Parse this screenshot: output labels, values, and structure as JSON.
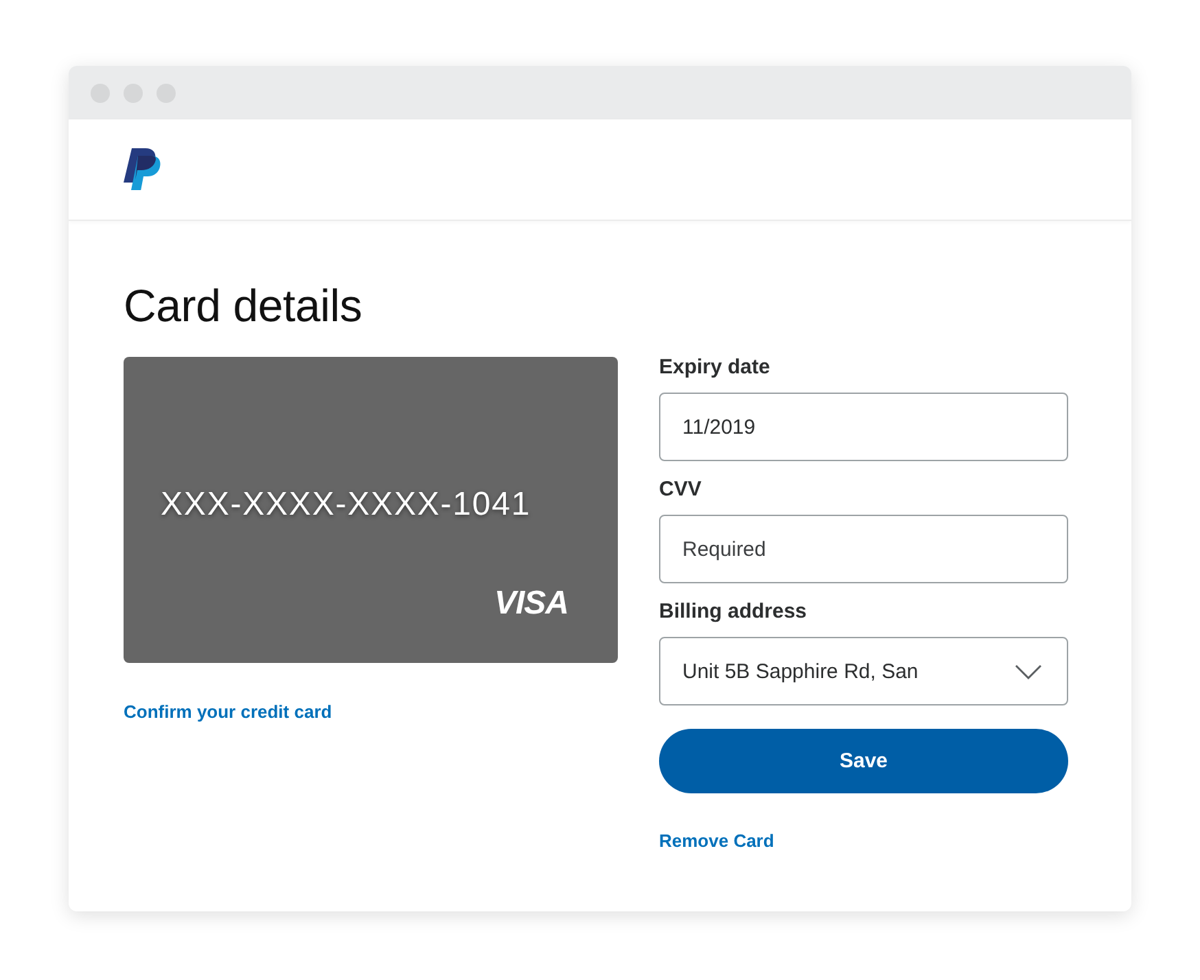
{
  "page": {
    "title": "Card details"
  },
  "card": {
    "number": "XXX-XXXX-XXXX-1041",
    "brand": "VISA"
  },
  "confirm_link": "Confirm your credit card",
  "form": {
    "fields": [
      {
        "kind": "text",
        "label": "Expiry date",
        "value": "11/2019"
      },
      {
        "kind": "text",
        "label": "CVV",
        "placeholder": "Required"
      },
      {
        "kind": "select",
        "label": "Billing address",
        "value": "Unit 5B Sapphire Rd, San"
      }
    ]
  },
  "save_button": "Save",
  "remove_link": "Remove Card"
}
